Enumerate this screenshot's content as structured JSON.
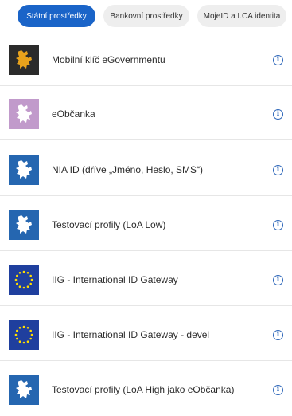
{
  "tabs": [
    {
      "label": "Státní prostředky",
      "active": true
    },
    {
      "label": "Bankovní prostředky",
      "active": false
    },
    {
      "label": "MojeID a I.CA identita",
      "active": false
    }
  ],
  "providers": [
    {
      "label": "Mobilní klíč eGovernmentu",
      "icon": "czech-lion-gold-on-dark-icon"
    },
    {
      "label": "eObčanka",
      "icon": "czech-lion-white-on-lilac-icon"
    },
    {
      "label": "NIA ID (dříve „Jméno, Heslo, SMS“)",
      "icon": "czech-lion-white-on-blue-icon"
    },
    {
      "label": "Testovací profily (LoA Low)",
      "icon": "czech-lion-white-on-blue-icon"
    },
    {
      "label": "IIG - International ID Gateway",
      "icon": "eu-flag-icon"
    },
    {
      "label": "IIG - International ID Gateway - devel",
      "icon": "eu-flag-icon"
    },
    {
      "label": "Testovací profily (LoA High jako eObčanka)",
      "icon": "czech-lion-white-on-blue-icon"
    }
  ],
  "info_glyph": "i",
  "colors": {
    "accent": "#1a64c8",
    "lion_dark_bg": "#2b2b2b",
    "lion_gold": "#e8a21c",
    "lilac_bg": "#c19acb",
    "blue_bg": "#2566b0",
    "eu_blue": "#1f3f9e",
    "eu_star": "#ffdd00"
  }
}
